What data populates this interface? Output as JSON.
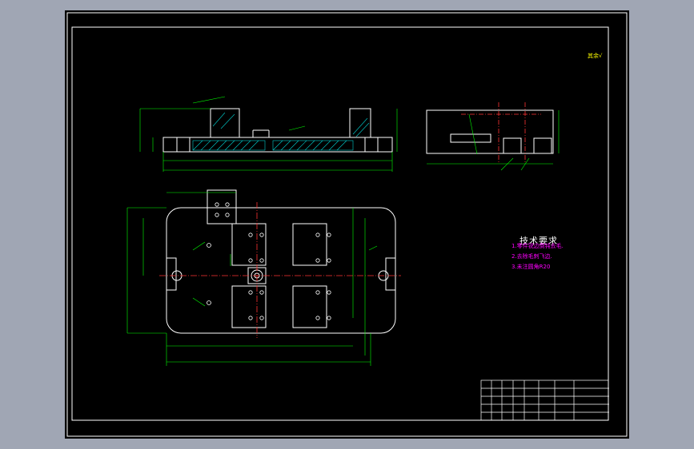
{
  "viewer": {
    "background": "#a0a6b4",
    "sheet_color": "#000000"
  },
  "drawing": {
    "technical_requirements": {
      "title": "技术要求",
      "items": [
        "1.零件锐边倒钝去毛.",
        "2.去除毛刺飞边.",
        "3.未注圆角R20"
      ]
    },
    "surface_note": "其余√",
    "colors": {
      "outline": "#ffffff",
      "dimension": "#00ff00",
      "centerline": "#ff3333",
      "hatch": "#00cccc",
      "text_magenta": "#ff00ff",
      "text_yellow": "#ffff00"
    }
  }
}
